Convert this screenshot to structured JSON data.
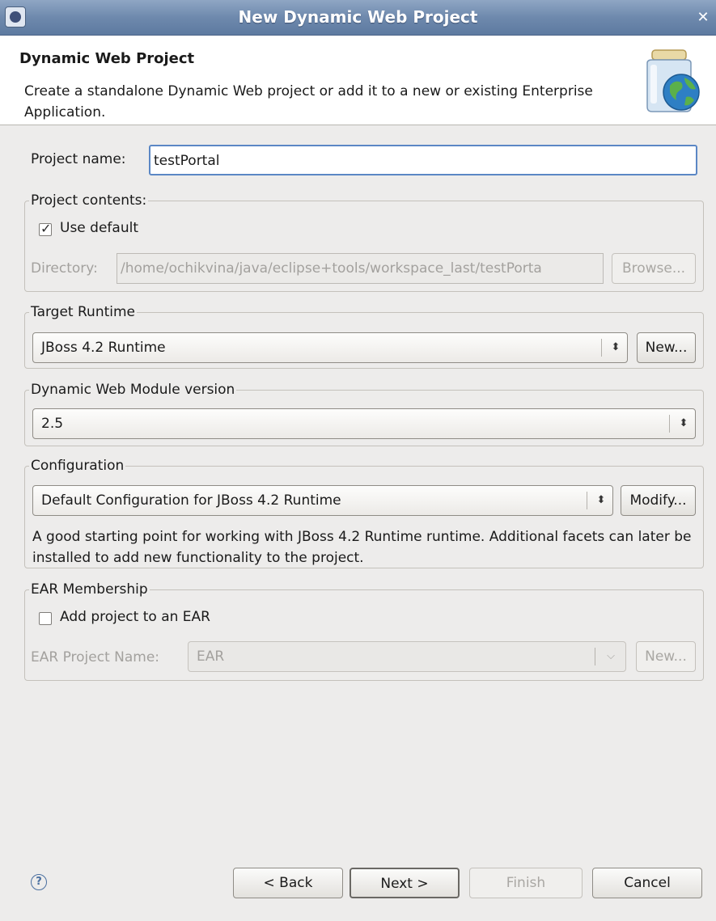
{
  "window": {
    "title": "New Dynamic Web Project"
  },
  "header": {
    "title": "Dynamic Web Project",
    "description": "Create a standalone Dynamic Web project or add it to a new or existing Enterprise Application."
  },
  "project_name": {
    "label": "Project name:",
    "value": "testPortal"
  },
  "project_contents": {
    "group_label": "Project contents:",
    "use_default_label": "Use default",
    "use_default_checked": true,
    "directory_label": "Directory:",
    "directory_value": "/home/ochikvina/java/eclipse+tools/workspace_last/testPorta",
    "browse_label": "Browse..."
  },
  "target_runtime": {
    "group_label": "Target Runtime",
    "selected": "JBoss 4.2 Runtime",
    "new_label": "New..."
  },
  "module_version": {
    "group_label": "Dynamic Web Module version",
    "selected": "2.5"
  },
  "configuration": {
    "group_label": "Configuration",
    "selected": "Default Configuration for JBoss 4.2 Runtime",
    "modify_label": "Modify...",
    "description": "A good starting point for working with JBoss 4.2 Runtime runtime. Additional facets can later be installed to add new functionality to the project."
  },
  "ear_membership": {
    "group_label": "EAR Membership",
    "add_label": "Add project to an EAR",
    "add_checked": false,
    "ear_name_label": "EAR Project Name:",
    "ear_name_value": "EAR",
    "new_label": "New..."
  },
  "footer": {
    "back_label": "< Back",
    "next_label": "Next >",
    "finish_label": "Finish",
    "cancel_label": "Cancel"
  },
  "icons": {
    "title_app": "eclipse-icon",
    "close": "close-icon",
    "header": "web-project-jar-globe-icon",
    "help": "help-icon"
  }
}
